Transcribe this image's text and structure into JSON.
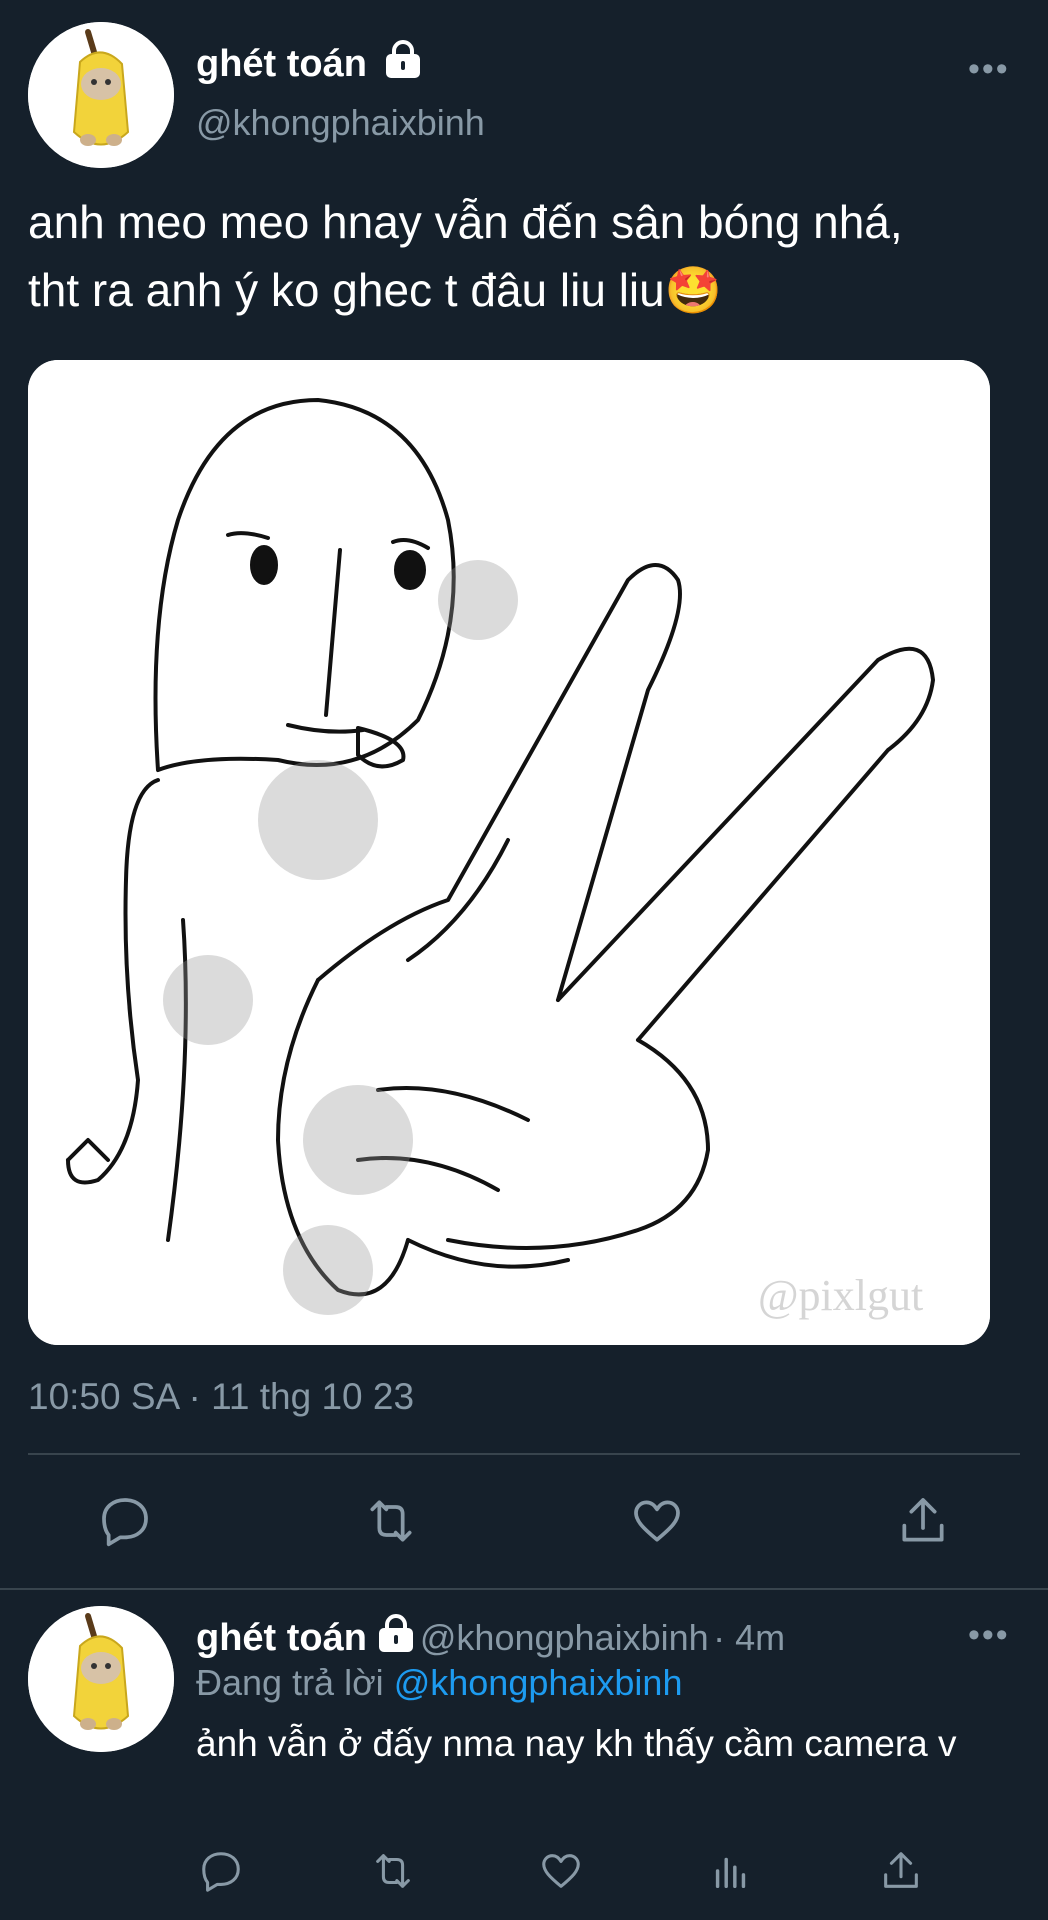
{
  "tweet": {
    "display_name": "ghét toán",
    "handle": "@khongphaixbinh",
    "text_line1": "anh meo meo hnay vẫn đến sân bóng nhá,",
    "text_line2": "tht ra anh ý ko ghec t đâu liu liu🤩",
    "media_watermark": "@pixlgut",
    "timestamp": "10:50 SA · 11 thg 10 23",
    "more_label": "•••"
  },
  "reply": {
    "display_name": "ghét toán",
    "handle": "@khongphaixbinh",
    "time": "· 4m",
    "replying_prefix": "Đang trả lời",
    "replying_to": "@khongphaixbinh",
    "text": "ảnh vẫn ở đấy nma nay kh thấy cầm camera v",
    "more_label": "•••"
  },
  "icons": {
    "lock": "lock-icon",
    "reply": "reply-icon",
    "retweet": "retweet-icon",
    "like": "heart-icon",
    "share": "share-icon",
    "analytics": "analytics-icon"
  },
  "colors": {
    "background": "#15202b",
    "secondary_text": "#8899a6",
    "link": "#1d9bf0",
    "divider": "#38444d"
  }
}
